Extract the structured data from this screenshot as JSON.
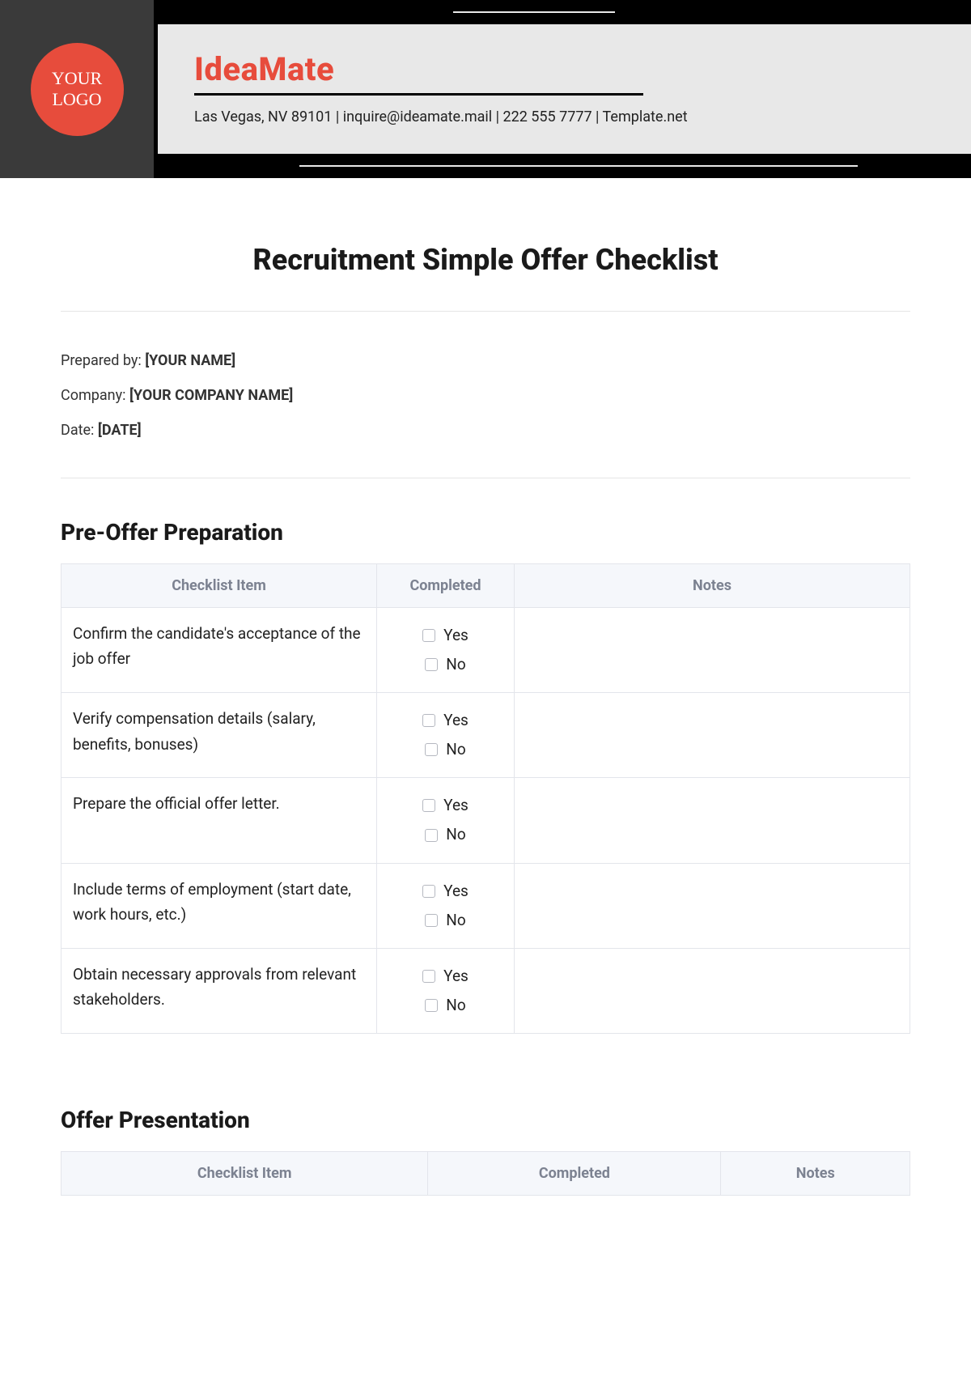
{
  "header": {
    "logo_line1": "YOUR",
    "logo_line2": "LOGO",
    "brand": "IdeaMate",
    "contact": "Las Vegas, NV 89101 | inquire@ideamate.mail | 222 555 7777 | Template.net"
  },
  "title": "Recruitment Simple Offer Checklist",
  "meta": {
    "prepared_label": "Prepared by: ",
    "prepared_value": "[YOUR NAME]",
    "company_label": "Company: ",
    "company_value": "[YOUR COMPANY NAME]",
    "date_label": "Date: ",
    "date_value": "[DATE]"
  },
  "columns": {
    "item": "Checklist Item",
    "completed": "Completed",
    "notes": "Notes",
    "yes": "Yes",
    "no": "No"
  },
  "sections": [
    {
      "heading": "Pre-Offer Preparation",
      "rows": [
        {
          "item": "Confirm the candidate's acceptance of the job offer"
        },
        {
          "item": "Verify compensation details (salary, benefits, bonuses)"
        },
        {
          "item": "Prepare the official offer letter."
        },
        {
          "item": "Include terms of employment (start date, work hours, etc.)"
        },
        {
          "item": "Obtain necessary approvals from relevant stakeholders."
        }
      ]
    },
    {
      "heading": "Offer Presentation",
      "rows": []
    }
  ]
}
